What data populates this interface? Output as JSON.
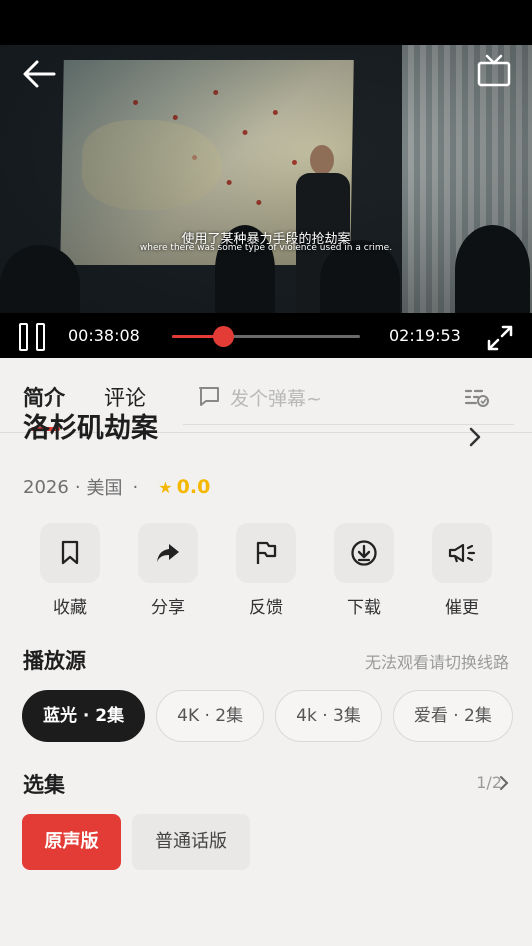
{
  "player": {
    "subtitle_cn": "使用了某种暴力手段的抢劫案",
    "subtitle_en": "where there was some type of violence used in a crime.",
    "current_time": "00:38:08",
    "total_time": "02:19:53",
    "progress_fraction": 0.272
  },
  "tabs": [
    {
      "label": "简介"
    },
    {
      "label": "评论"
    }
  ],
  "danmu": {
    "placeholder": "发个弹幕~"
  },
  "movie": {
    "title": "洛杉矶劫案",
    "year": "2026",
    "region": "美国",
    "score": "0.0"
  },
  "actions": [
    {
      "label": "收藏",
      "icon": "bookmark-icon"
    },
    {
      "label": "分享",
      "icon": "share-icon"
    },
    {
      "label": "反馈",
      "icon": "flag-icon"
    },
    {
      "label": "下载",
      "icon": "download-icon"
    },
    {
      "label": "催更",
      "icon": "megaphone-icon"
    }
  ],
  "sources": {
    "heading": "播放源",
    "hint": "无法观看请切换线路",
    "items": [
      "蓝光 · 2集",
      "4K · 2集",
      "4k · 3集",
      "爱看 · 2集"
    ]
  },
  "episodes": {
    "heading": "选集",
    "page": "1/2",
    "versions": [
      "原声版",
      "普通话版"
    ]
  },
  "colors": {
    "accent": "#e33b35",
    "star": "#f5b800"
  }
}
